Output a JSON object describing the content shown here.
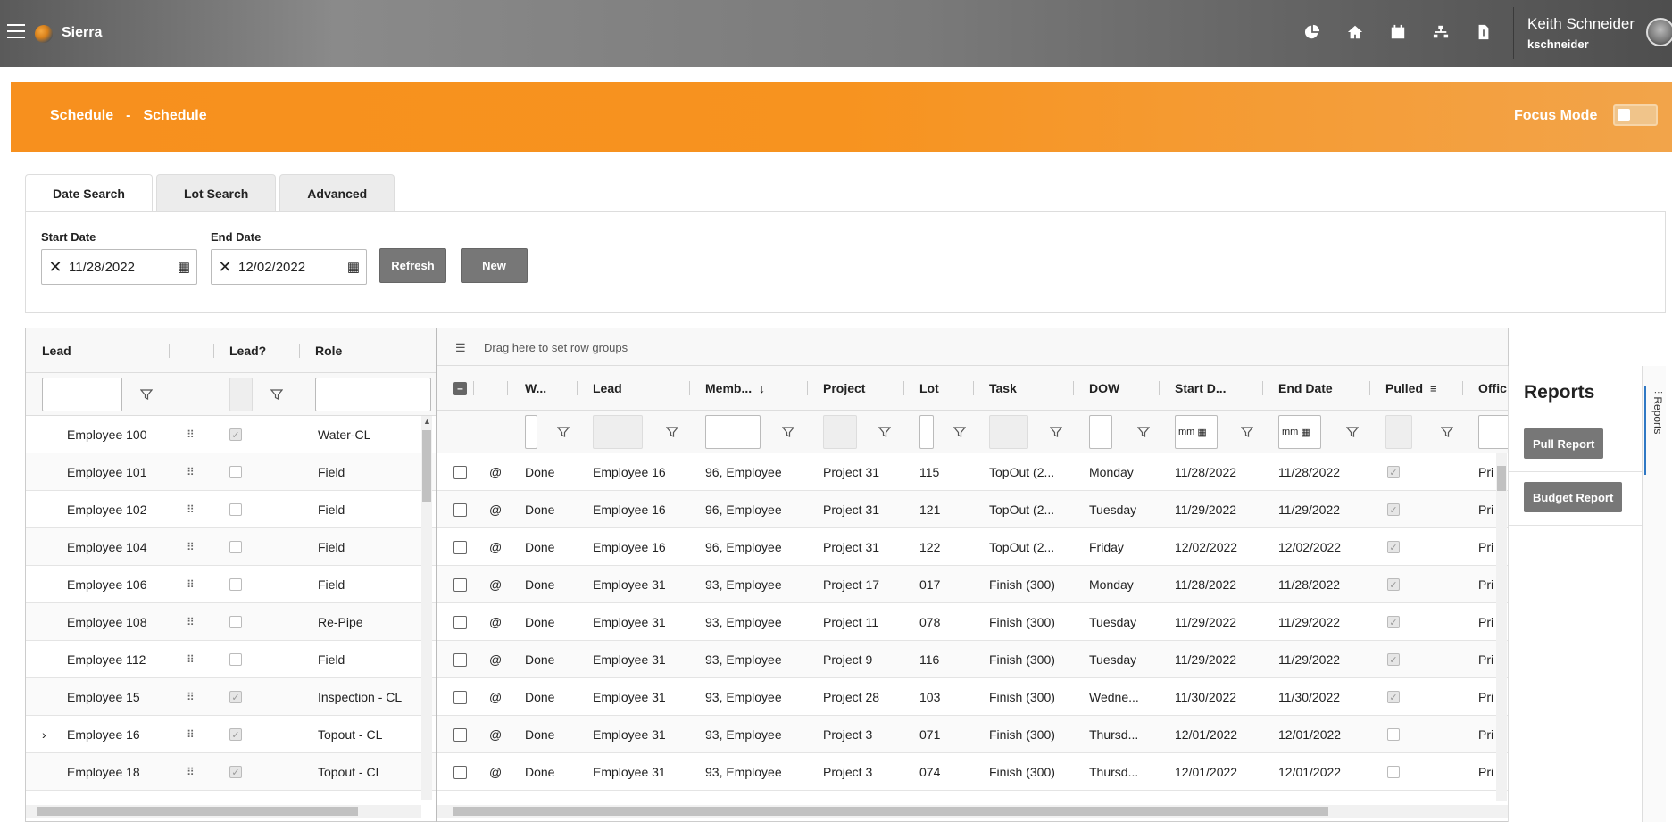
{
  "app": {
    "title": "Sierra"
  },
  "user": {
    "name": "Keith Schneider",
    "login": "kschneider"
  },
  "header": {
    "breadcrumb": [
      "Schedule",
      "Schedule"
    ],
    "separator": "-",
    "focus_mode_label": "Focus Mode"
  },
  "tabs": [
    {
      "label": "Date Search",
      "active": true
    },
    {
      "label": "Lot Search"
    },
    {
      "label": "Advanced"
    }
  ],
  "search": {
    "start_label": "Start Date",
    "start_value": "11/28/2022",
    "end_label": "End Date",
    "end_value": "12/02/2022",
    "refresh_label": "Refresh",
    "new_label": "New"
  },
  "left_grid": {
    "columns": [
      "Lead",
      "Lead?",
      "Role"
    ],
    "rows": [
      {
        "lead": "Employee 100",
        "checked": true,
        "role": "Water-CL"
      },
      {
        "lead": "Employee 101",
        "checked": false,
        "role": "Field"
      },
      {
        "lead": "Employee 102",
        "checked": false,
        "role": "Field"
      },
      {
        "lead": "Employee 104",
        "checked": false,
        "role": "Field"
      },
      {
        "lead": "Employee 106",
        "checked": false,
        "role": "Field"
      },
      {
        "lead": "Employee 108",
        "checked": false,
        "role": "Re-Pipe"
      },
      {
        "lead": "Employee 112",
        "checked": false,
        "role": "Field"
      },
      {
        "lead": "Employee 15",
        "checked": true,
        "role": "Inspection - CL"
      },
      {
        "lead": "Employee 16",
        "checked": true,
        "role": "Topout - CL",
        "expand": "›"
      },
      {
        "lead": "Employee 18",
        "checked": true,
        "role": "Topout - CL"
      }
    ]
  },
  "main_grid": {
    "rowgroup_hint": "Drag here to set row groups",
    "columns": [
      "W...",
      "Lead",
      "Memb...",
      "Project",
      "Lot",
      "Task",
      "DOW",
      "Start D...",
      "End Date",
      "Pulled",
      "Offic"
    ],
    "date_placeholder": "mm",
    "rows": [
      {
        "at": "@",
        "w": "Done",
        "lead": "Employee 16",
        "member": "96, Employee",
        "project": "Project 31",
        "lot": "115",
        "task": "TopOut (2...",
        "dow": "Monday",
        "start": "11/28/2022",
        "end": "11/28/2022",
        "pulled": true,
        "office": "Pri"
      },
      {
        "at": "@",
        "w": "Done",
        "lead": "Employee 16",
        "member": "96, Employee",
        "project": "Project 31",
        "lot": "121",
        "task": "TopOut (2...",
        "dow": "Tuesday",
        "start": "11/29/2022",
        "end": "11/29/2022",
        "pulled": true,
        "office": "Pri"
      },
      {
        "at": "@",
        "w": "Done",
        "lead": "Employee 16",
        "member": "96, Employee",
        "project": "Project 31",
        "lot": "122",
        "task": "TopOut (2...",
        "dow": "Friday",
        "start": "12/02/2022",
        "end": "12/02/2022",
        "pulled": true,
        "office": "Pri"
      },
      {
        "at": "@",
        "w": "Done",
        "lead": "Employee 31",
        "member": "93, Employee",
        "project": "Project 17",
        "lot": "017",
        "task": "Finish (300)",
        "dow": "Monday",
        "start": "11/28/2022",
        "end": "11/28/2022",
        "pulled": true,
        "office": "Pri"
      },
      {
        "at": "@",
        "w": "Done",
        "lead": "Employee 31",
        "member": "93, Employee",
        "project": "Project 11",
        "lot": "078",
        "task": "Finish (300)",
        "dow": "Tuesday",
        "start": "11/29/2022",
        "end": "11/29/2022",
        "pulled": true,
        "office": "Pri"
      },
      {
        "at": "@",
        "w": "Done",
        "lead": "Employee 31",
        "member": "93, Employee",
        "project": "Project 9",
        "lot": "116",
        "task": "Finish (300)",
        "dow": "Tuesday",
        "start": "11/29/2022",
        "end": "11/29/2022",
        "pulled": true,
        "office": "Pri"
      },
      {
        "at": "@",
        "w": "Done",
        "lead": "Employee 31",
        "member": "93, Employee",
        "project": "Project 28",
        "lot": "103",
        "task": "Finish (300)",
        "dow": "Wedne...",
        "start": "11/30/2022",
        "end": "11/30/2022",
        "pulled": true,
        "office": "Pri"
      },
      {
        "at": "@",
        "w": "Done",
        "lead": "Employee 31",
        "member": "93, Employee",
        "project": "Project 3",
        "lot": "071",
        "task": "Finish (300)",
        "dow": "Thursd...",
        "start": "12/01/2022",
        "end": "12/01/2022",
        "pulled": false,
        "office": "Pri"
      },
      {
        "at": "@",
        "w": "Done",
        "lead": "Employee 31",
        "member": "93, Employee",
        "project": "Project 3",
        "lot": "074",
        "task": "Finish (300)",
        "dow": "Thursd...",
        "start": "12/01/2022",
        "end": "12/01/2022",
        "pulled": false,
        "office": "Pri"
      }
    ]
  },
  "reports": {
    "title": "Reports",
    "pull_label": "Pull Report",
    "budget_label": "Budget Report",
    "side_tab_label": "Reports"
  },
  "icons": {
    "menu": "hamburger-icon",
    "nav": [
      "pie-chart-icon",
      "home-icon",
      "calendar-icon",
      "sitemap-icon",
      "document-dollar-icon"
    ]
  },
  "colors": {
    "accent": "#f7931f",
    "topbar": "#7a7a7a",
    "button": "#777777"
  }
}
